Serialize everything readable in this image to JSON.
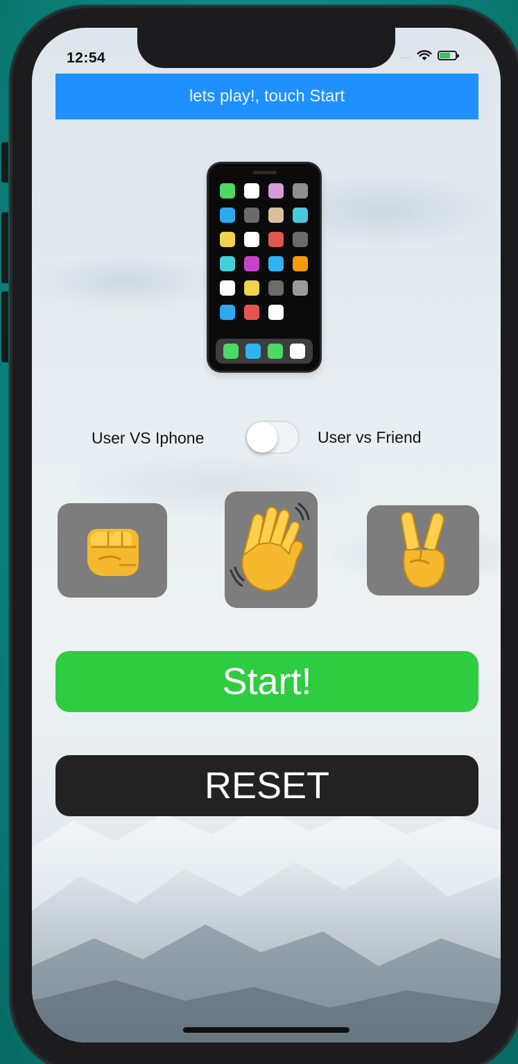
{
  "status_bar": {
    "time": "12:54",
    "signal": "....",
    "wifi_icon": "wifi-icon",
    "battery_icon": "battery-charging-icon"
  },
  "banner": {
    "text": "lets play!, touch Start"
  },
  "opponent_icon": "mobile-phone-icon",
  "mode_switch": {
    "left_label": "User VS Iphone",
    "right_label": "User vs Friend",
    "state": "off"
  },
  "choices": [
    {
      "icon": "rock-fist-icon"
    },
    {
      "icon": "paper-hand-icon"
    },
    {
      "icon": "scissors-victory-hand-icon"
    }
  ],
  "buttons": {
    "start_label": "Start!",
    "reset_label": "RESET"
  },
  "colors": {
    "banner": "#1e90ff",
    "start": "#2ecc40",
    "reset": "#222222",
    "choice_bg": "#7d7d7d"
  }
}
